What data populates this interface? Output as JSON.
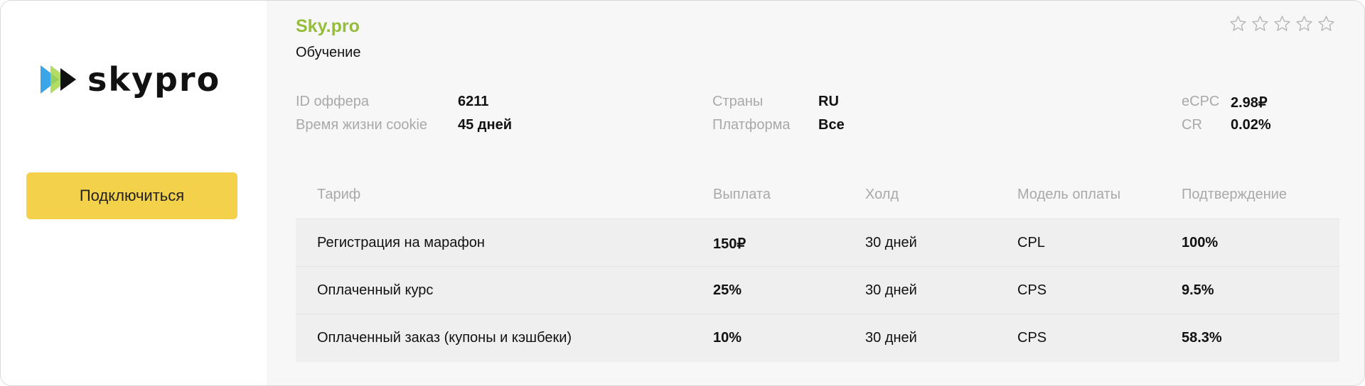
{
  "offer": {
    "logo_text": "skypro",
    "brand_name": "Sky.pro",
    "category": "Обучение",
    "connect_label": "Подключиться",
    "rating": 0,
    "rating_max": 5
  },
  "info": {
    "offer_id_label": "ID оффера",
    "offer_id_value": "6211",
    "cookie_label": "Время жизни cookie",
    "cookie_value": "45 дней",
    "countries_label": "Страны",
    "countries_value": "RU",
    "platform_label": "Платформа",
    "platform_value": "Все",
    "ecpc_label": "eCPC",
    "ecpc_value": "2.98₽",
    "cr_label": "CR",
    "cr_value": "0.02%"
  },
  "table": {
    "headers": [
      "Тариф",
      "Выплата",
      "Холд",
      "Модель оплаты",
      "Подтверждение"
    ],
    "rows": [
      [
        "Регистрация на марафон",
        "150₽",
        "30 дней",
        "CPL",
        "100%"
      ],
      [
        "Оплаченный курс",
        "25%",
        "30 дней",
        "CPS",
        "9.5%"
      ],
      [
        "Оплаченный заказ (купоны и кэшбеки)",
        "10%",
        "30 дней",
        "CPS",
        "58.3%"
      ]
    ]
  },
  "colors": {
    "brand": "#95bd3c",
    "button": "#f4d14a",
    "logo_blue": "#3aa6e8",
    "logo_green": "#a6d64a"
  },
  "icons": {
    "logo": "skypro-play-icon",
    "rating": "star-outline-icon"
  }
}
